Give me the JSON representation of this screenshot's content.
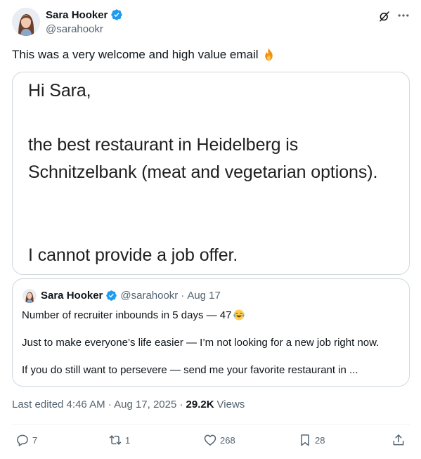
{
  "author": {
    "display_name": "Sara Hooker",
    "handle": "@sarahookr"
  },
  "tweet": {
    "text": "This was a very welcome and high value email",
    "emoji": "fire-emoji"
  },
  "media": {
    "lines": [
      "Hi Sara,",
      "the best restaurant in Heidelberg is",
      "Schnitzelbank (meat and vegetarian options).",
      "I cannot provide a job offer."
    ]
  },
  "quote": {
    "display_name": "Sara Hooker",
    "handle": "@sarahookr",
    "separator": "·",
    "date": "Aug 17",
    "line1": "Number of recruiter inbounds in 5 days — 47",
    "line2": "Just to make everyone’s life easier — I’m not looking for a new job right now.",
    "line3": "If you do still want to persevere — send me your favorite restaurant in ..."
  },
  "meta": {
    "edited": "Last edited 4:46 AM · Aug 17, 2025 ·",
    "views_count": "29.2K",
    "views_label": "Views"
  },
  "actions": {
    "replies": "7",
    "reposts": "1",
    "likes": "268",
    "bookmarks": "28"
  },
  "colors": {
    "verified": "#1d9bf0",
    "secondary_text": "#536471",
    "border": "#cfd9de"
  }
}
